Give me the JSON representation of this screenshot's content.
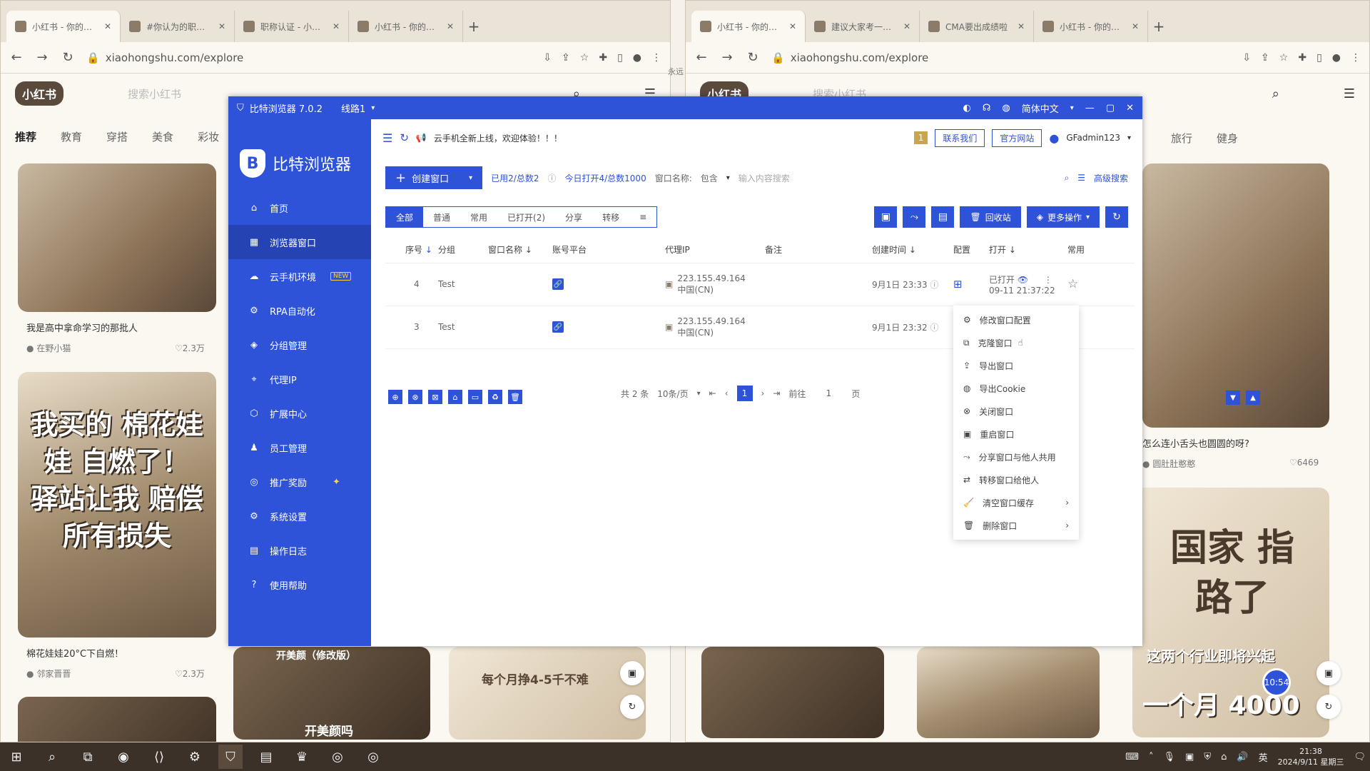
{
  "left_browser": {
    "tabs": [
      "小红书 - 你的生活",
      "#你认为的职称计…",
      "职称认证 - 小红书",
      "小红书 - 你的生活"
    ],
    "url": "xiaohongshu.com/explore",
    "logo": "小红书",
    "search_placeholder": "搜索小红书",
    "channels": [
      "推荐",
      "教育",
      "穿搭",
      "美食",
      "彩妆"
    ],
    "cards": [
      {
        "title": "我是高中拿命学习的那批人",
        "author": "在野小猫",
        "likes": "2.3万"
      },
      {
        "overlay": "我买的 棉花娃娃 自燃了！ 驿站让我 赔偿所有损失",
        "title": "棉花娃娃20°C下自燃！",
        "author": "邻家晋晋",
        "likes": "2.3万"
      }
    ],
    "bottom_overlay_1": "开美颜吗",
    "bottom_overlay_2": "每个月挣4-5千不难",
    "bottom_overlay_3": "开美颜（修改版）"
  },
  "right_browser": {
    "tabs": [
      "小红书 - 你的生活",
      "建议大家考一个职…",
      "CMA要出成绩啦",
      "小红书 - 你的生活"
    ],
    "url": "xiaohongshu.com/explore",
    "logo": "小红书",
    "search_placeholder": "搜索小红书",
    "channels": [
      "旅行",
      "健身"
    ],
    "card1": {
      "title": "怎么连小舌头也圆圆的呀?",
      "author": "圆肚肚憨憨",
      "likes": "6469"
    },
    "overlay_big": "国家 指路了",
    "overlay_line": "这两个行业即将兴起",
    "overlay_money": "一个月 4000",
    "badge_time": "10:54",
    "stray_text": "永远"
  },
  "app": {
    "title": "比特浏览器 7.0.2",
    "line": "线路1",
    "language": "简体中文",
    "brand": "比特浏览器",
    "menu": [
      {
        "icon": "⌂",
        "label": "首页",
        "name": "home"
      },
      {
        "icon": "▦",
        "label": "浏览器窗口",
        "name": "browser-windows"
      },
      {
        "icon": "☁",
        "label": "云手机环境",
        "name": "cloud-phone",
        "badge": "NEW"
      },
      {
        "icon": "⚙",
        "label": "RPA自动化",
        "name": "rpa"
      },
      {
        "icon": "◈",
        "label": "分组管理",
        "name": "groups"
      },
      {
        "icon": "⌖",
        "label": "代理IP",
        "name": "proxy-ip"
      },
      {
        "icon": "⬡",
        "label": "扩展中心",
        "name": "extensions"
      },
      {
        "icon": "♟",
        "label": "员工管理",
        "name": "staff"
      },
      {
        "icon": "◎",
        "label": "推广奖励",
        "name": "promotion"
      },
      {
        "icon": "⚙",
        "label": "系统设置",
        "name": "settings"
      },
      {
        "icon": "▤",
        "label": "操作日志",
        "name": "logs"
      },
      {
        "icon": "?",
        "label": "使用帮助",
        "name": "help"
      }
    ],
    "notice": "云手机全新上线，欢迎体验！！！",
    "notice_count": "1",
    "contact": "联系我们",
    "website": "官方网站",
    "user": "GFadmin123",
    "create": "创建窗口",
    "used_label": "已用2/总数2",
    "today_label": "今日打开4/总数1000",
    "filter_label": "窗口名称:",
    "filter_mode": "包含",
    "filter_placeholder": "输入内容搜索",
    "adv_search": "高级搜索",
    "tabs": [
      "全部",
      "普通",
      "常用",
      "已打开(2)",
      "分享",
      "转移"
    ],
    "recycle": "回收站",
    "more_ops": "更多操作",
    "columns": [
      "序号",
      "分组",
      "窗口名称",
      "账号平台",
      "代理IP",
      "备注",
      "创建时间",
      "配置",
      "打开",
      "常用"
    ],
    "rows": [
      {
        "seq": "4",
        "group": "Test",
        "ip": "223.155.49.164",
        "region": "中国(CN)",
        "created": "9月1日 23:33",
        "status": "已打开",
        "opened_time": "09-11 21:37:22"
      },
      {
        "seq": "3",
        "group": "Test",
        "ip": "223.155.49.164",
        "region": "中国(CN)",
        "created": "9月1日 23:32",
        "status": "",
        "opened_time": ""
      }
    ],
    "pager": {
      "total": "共 2 条",
      "per_page": "10条/页",
      "current": "1",
      "goto": "前往",
      "goto_value": "1",
      "page_unit": "页"
    },
    "context_menu": [
      {
        "icon": "⚙",
        "label": "修改窗口配置"
      },
      {
        "icon": "⧉",
        "label": "克隆窗口"
      },
      {
        "icon": "⇪",
        "label": "导出窗口"
      },
      {
        "icon": "◍",
        "label": "导出Cookie"
      },
      {
        "icon": "⊗",
        "label": "关闭窗口"
      },
      {
        "icon": "▣",
        "label": "重启窗口"
      },
      {
        "icon": "⤳",
        "label": "分享窗口与他人共用"
      },
      {
        "icon": "⇄",
        "label": "转移窗口给他人"
      },
      {
        "icon": "🧹",
        "label": "清空窗口缓存",
        "arrow": "›"
      },
      {
        "icon": "🗑",
        "label": "删除窗口",
        "arrow": "›"
      }
    ]
  },
  "taskbar": {
    "time": "21:38",
    "date": "2024/9/11 星期三",
    "ime": "英"
  }
}
